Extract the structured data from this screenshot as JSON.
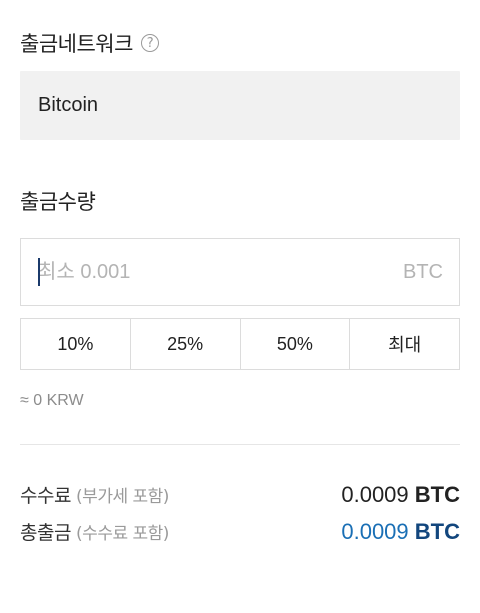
{
  "network": {
    "label": "출금네트워크",
    "help_icon": "question-circle-icon",
    "help_glyph": "?",
    "value": "Bitcoin"
  },
  "amount": {
    "label": "출금수량",
    "placeholder": "최소 0.001",
    "value": "",
    "unit": "BTC"
  },
  "percent_buttons": [
    "10%",
    "25%",
    "50%",
    "최대"
  ],
  "krw_estimate": "≈ 0 KRW",
  "summary": {
    "fee": {
      "label": "수수료",
      "note": "(부가세 포함)",
      "amount": "0.0009",
      "unit": "BTC"
    },
    "total": {
      "label": "총출금",
      "note": "(수수료 포함)",
      "amount": "0.0009",
      "unit": "BTC"
    }
  },
  "colors": {
    "total_value": "#1a6fb5",
    "total_unit": "#12467d",
    "input_caret": "#1b3a6b",
    "network_box_bg": "#f1f1f1"
  }
}
